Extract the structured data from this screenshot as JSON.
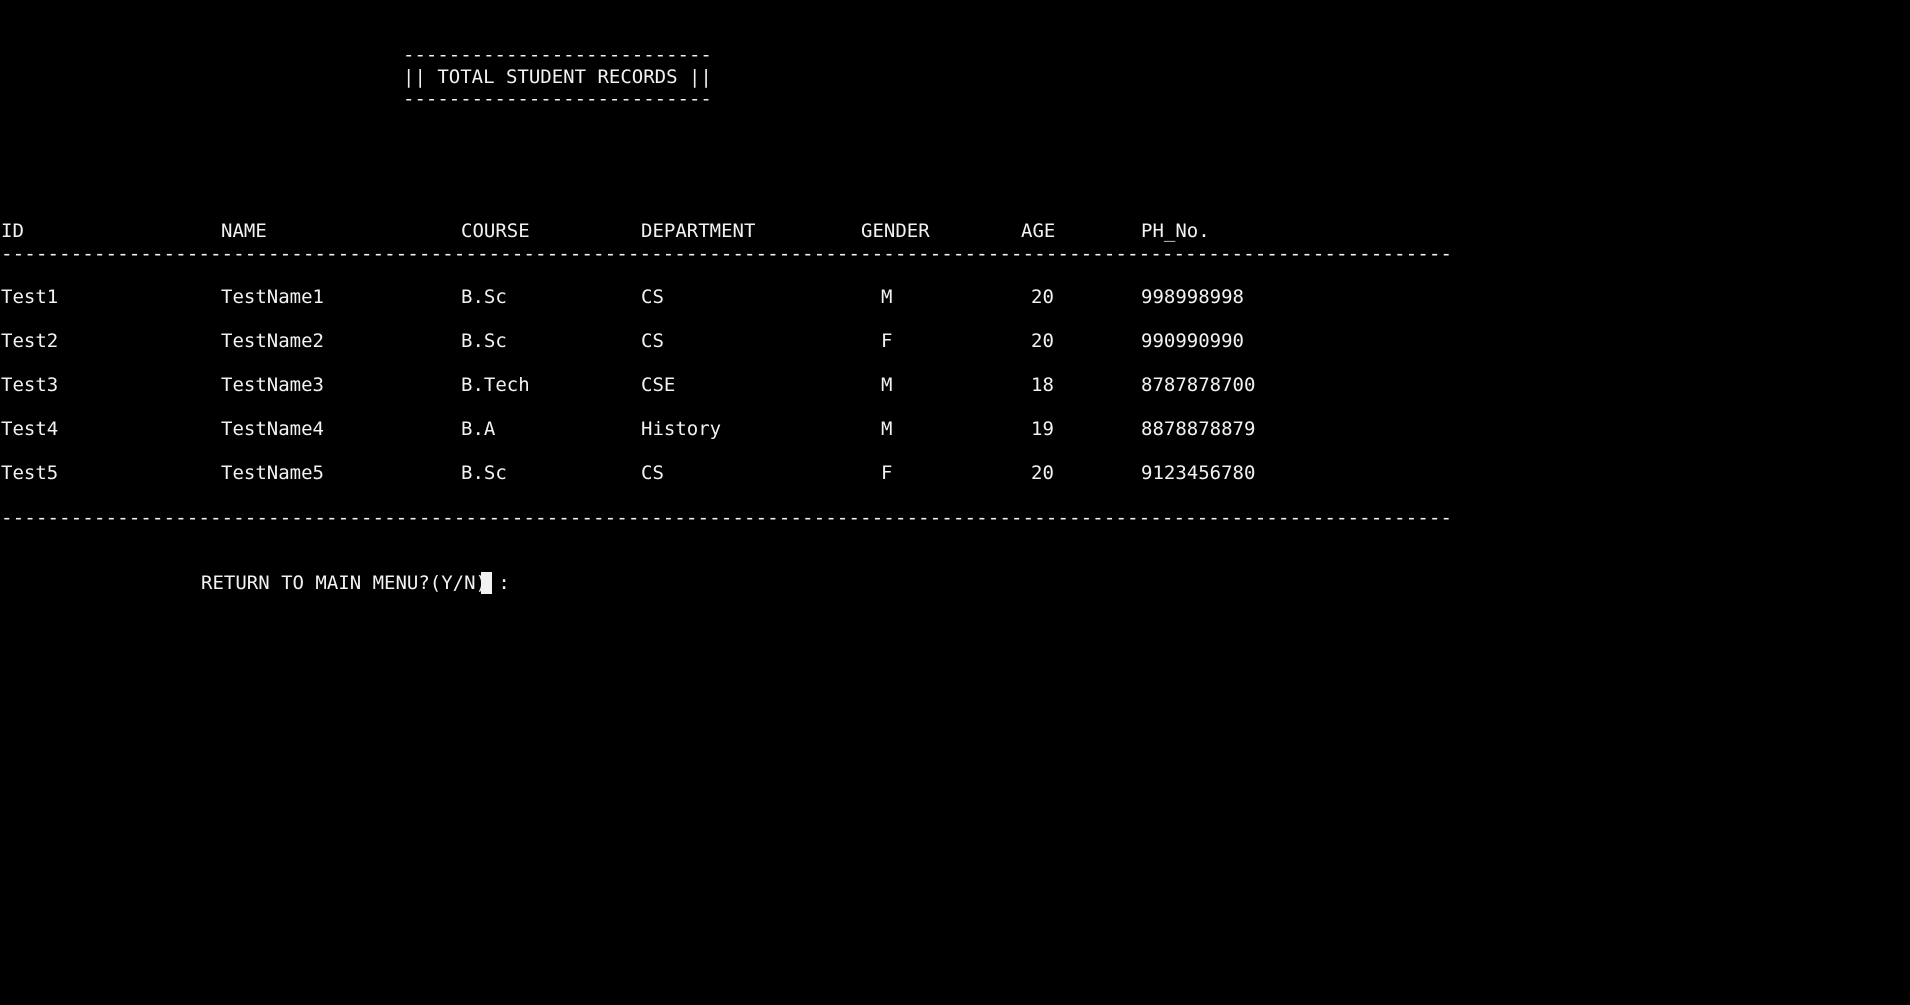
{
  "header": {
    "rule_top": "---------------------------",
    "title": "|| TOTAL STUDENT RECORDS ||",
    "rule_bottom": "---------------------------"
  },
  "table": {
    "columns": [
      "ID",
      "NAME",
      "COURSE",
      "DEPARTMENT",
      "GENDER",
      "AGE",
      "PH_No."
    ],
    "divider": "-----------------------------------------------------------------------------------------------------------------------------",
    "rows": [
      [
        "Test1",
        "TestName1",
        "B.Sc",
        "CS",
        "M",
        "20",
        "998998998"
      ],
      [
        "Test2",
        "TestName2",
        "B.Sc",
        "CS",
        "F",
        "20",
        "990990990"
      ],
      [
        "Test3",
        "TestName3",
        "B.Tech",
        "CSE",
        "M",
        "18",
        "8787878700"
      ],
      [
        "Test4",
        "TestName4",
        "B.A",
        "History",
        "M",
        "19",
        "8878878879"
      ],
      [
        "Test5",
        "TestName5",
        "B.Sc",
        "CS",
        "F",
        "20",
        "9123456780"
      ]
    ]
  },
  "prompt": {
    "text": "RETURN TO MAIN MENU?(Y/N) :"
  },
  "colors": {
    "background": "#000000",
    "foreground": "#f2f2f2"
  }
}
